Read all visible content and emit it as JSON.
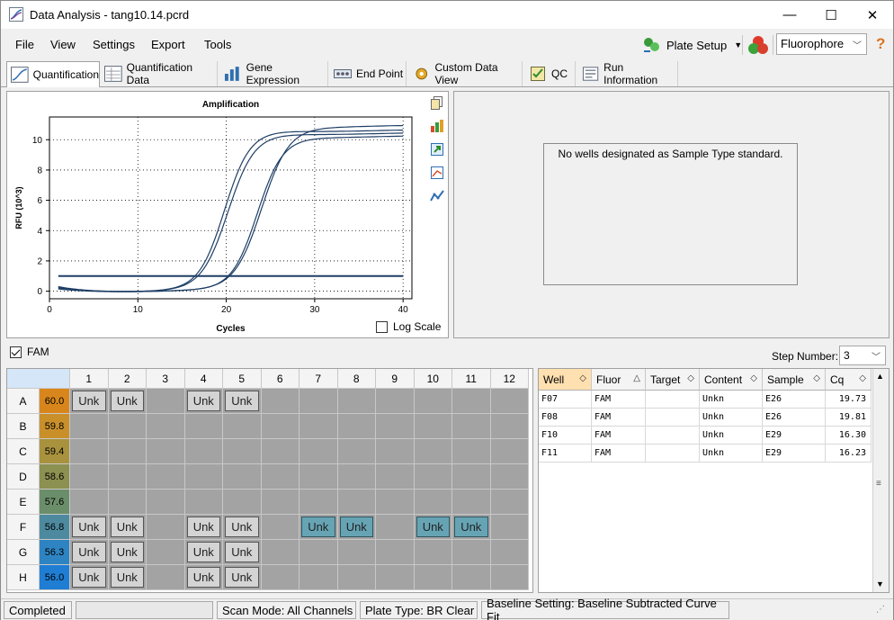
{
  "window": {
    "title": "Data Analysis - tang10.14.pcrd",
    "minimize": "—",
    "maximize": "☐",
    "close": "✕"
  },
  "menu": {
    "items": [
      "File",
      "View",
      "Settings",
      "Export",
      "Tools"
    ],
    "plate_setup": "Plate Setup",
    "fluorophore": "Fluorophore",
    "help": "?"
  },
  "tabs": [
    "Quantification",
    "Quantification Data",
    "Gene Expression",
    "End Point",
    "Custom Data View",
    "QC",
    "Run Information"
  ],
  "chart_data": {
    "type": "line",
    "title": "Amplification",
    "xlabel": "Cycles",
    "ylabel": "RFU (10^3)",
    "xlim": [
      0,
      41
    ],
    "ylim": [
      -0.5,
      11.5
    ],
    "xticks": [
      0,
      10,
      20,
      30,
      40
    ],
    "yticks": [
      0,
      2,
      4,
      6,
      8,
      10
    ],
    "grid": true,
    "threshold": 1.0,
    "series": [
      {
        "plateau": 10.6,
        "midpoint": 19.8,
        "slope": 1.45,
        "baseline": 0.3
      },
      {
        "plateau": 10.4,
        "midpoint": 20.2,
        "slope": 1.5,
        "baseline": 0.25
      },
      {
        "plateau": 10.2,
        "midpoint": 23.5,
        "slope": 1.45,
        "baseline": 0.2
      },
      {
        "plateau": 10.9,
        "midpoint": 24.0,
        "slope": 1.55,
        "baseline": 0.15
      }
    ],
    "series_color": "#1f3f66",
    "log_scale_label": "Log Scale"
  },
  "standard_curve": {
    "message": "No wells designated as Sample Type standard."
  },
  "fluor_row": {
    "label": "FAM",
    "step_label": "Step Number:",
    "step_value": "3"
  },
  "plate": {
    "columns": [
      "1",
      "2",
      "3",
      "4",
      "5",
      "6",
      "7",
      "8",
      "9",
      "10",
      "11",
      "12"
    ],
    "rows": [
      {
        "label": "A",
        "temp": "60.0",
        "color": "#d8861c"
      },
      {
        "label": "B",
        "temp": "59.8",
        "color": "#c9902a"
      },
      {
        "label": "C",
        "temp": "59.4",
        "color": "#a9923e"
      },
      {
        "label": "D",
        "temp": "58.6",
        "color": "#8c9050"
      },
      {
        "label": "E",
        "temp": "57.6",
        "color": "#6b8e6a"
      },
      {
        "label": "F",
        "temp": "56.8",
        "color": "#4d8aa0"
      },
      {
        "label": "G",
        "temp": "56.3",
        "color": "#2e84c2"
      },
      {
        "label": "H",
        "temp": "56.0",
        "color": "#1f7ed4"
      }
    ],
    "wells": {
      "A": {
        "1": "Unk",
        "2": "Unk",
        "4": "Unk",
        "5": "Unk"
      },
      "F": {
        "1": "Unk",
        "2": "Unk",
        "4": "Unk",
        "5": "Unk",
        "7": "Unk*",
        "8": "Unk*",
        "10": "Unk*",
        "11": "Unk*"
      },
      "G": {
        "1": "Unk",
        "2": "Unk",
        "4": "Unk",
        "5": "Unk"
      },
      "H": {
        "1": "Unk",
        "2": "Unk",
        "4": "Unk",
        "5": "Unk"
      }
    }
  },
  "results_table": {
    "headers": [
      "Well",
      "Fluor",
      "Target",
      "Content",
      "Sample",
      "Cq"
    ],
    "rows": [
      [
        "F07",
        "FAM",
        "",
        "Unkn",
        "E26",
        "19.73"
      ],
      [
        "F08",
        "FAM",
        "",
        "Unkn",
        "E26",
        "19.81"
      ],
      [
        "F10",
        "FAM",
        "",
        "Unkn",
        "E29",
        "16.30"
      ],
      [
        "F11",
        "FAM",
        "",
        "Unkn",
        "E29",
        "16.23"
      ]
    ]
  },
  "status": {
    "state": "Completed",
    "scan_mode": "Scan Mode: All Channels",
    "plate_type": "Plate Type: BR Clear",
    "baseline": "Baseline Setting: Baseline Subtracted Curve Fit"
  }
}
